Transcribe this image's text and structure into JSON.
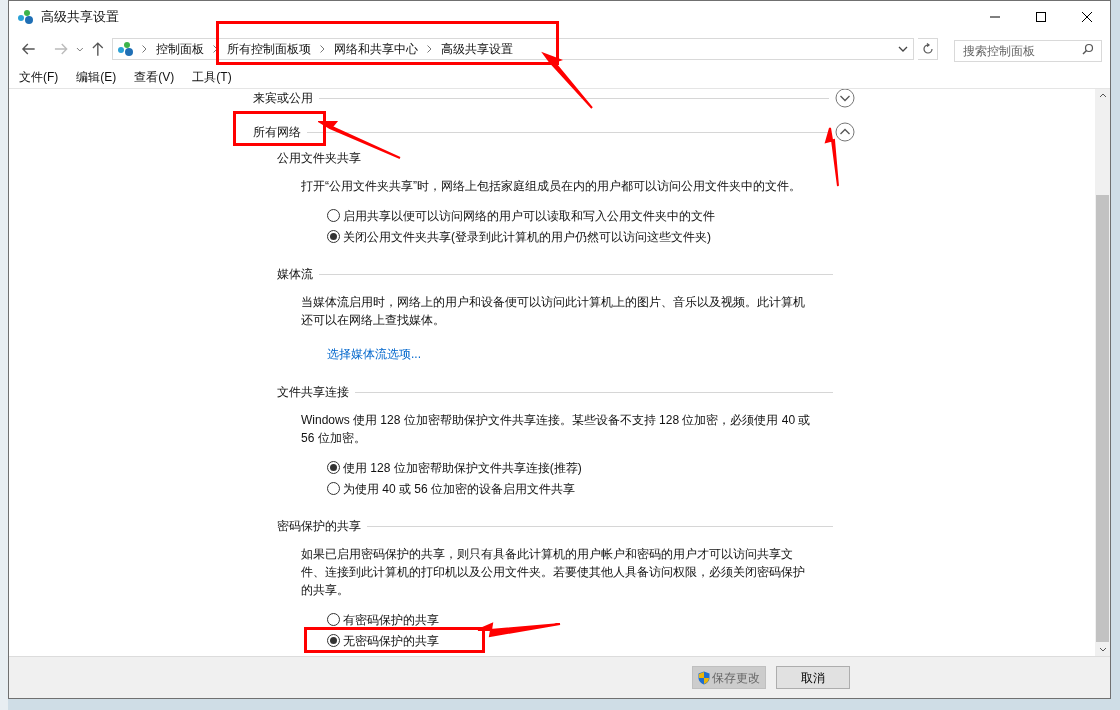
{
  "window": {
    "title": "高级共享设置"
  },
  "breadcrumb": [
    "控制面板",
    "所有控制面板项",
    "网络和共享中心",
    "高级共享设置"
  ],
  "search": {
    "placeholder": "搜索控制面板"
  },
  "menu": [
    "文件(F)",
    "编辑(E)",
    "查看(V)",
    "工具(T)"
  ],
  "profiles": [
    {
      "title": "来宾或公用",
      "expanded": false
    },
    {
      "title": "所有网络",
      "expanded": true
    }
  ],
  "sections": [
    {
      "title": "公用文件夹共享",
      "description": "打开“公用文件夹共享”时，网络上包括家庭组成员在内的用户都可以访问公用文件夹中的文件。",
      "options": [
        {
          "label": "启用共享以便可以访问网络的用户可以读取和写入公用文件夹中的文件",
          "selected": false
        },
        {
          "label": "关闭公用文件夹共享(登录到此计算机的用户仍然可以访问这些文件夹)",
          "selected": true
        }
      ]
    },
    {
      "title": "媒体流",
      "description": "当媒体流启用时，网络上的用户和设备便可以访问此计算机上的图片、音乐以及视频。此计算机还可以在网络上查找媒体。",
      "link": "选择媒体流选项..."
    },
    {
      "title": "文件共享连接",
      "description": "Windows 使用 128 位加密帮助保护文件共享连接。某些设备不支持 128 位加密，必须使用 40 或 56 位加密。",
      "options": [
        {
          "label": "使用 128 位加密帮助保护文件共享连接(推荐)",
          "selected": true
        },
        {
          "label": "为使用 40 或 56 位加密的设备启用文件共享",
          "selected": false
        }
      ]
    },
    {
      "title": "密码保护的共享",
      "description": "如果已启用密码保护的共享，则只有具备此计算机的用户帐户和密码的用户才可以访问共享文件、连接到此计算机的打印机以及公用文件夹。若要使其他人具备访问权限，必须关闭密码保护的共享。",
      "options": [
        {
          "label": "有密码保护的共享",
          "selected": false
        },
        {
          "label": "无密码保护的共享",
          "selected": true
        }
      ]
    }
  ],
  "buttons": [
    {
      "label": "保存更改",
      "kind": "shield"
    },
    {
      "label": "取消",
      "kind": "plain"
    }
  ]
}
